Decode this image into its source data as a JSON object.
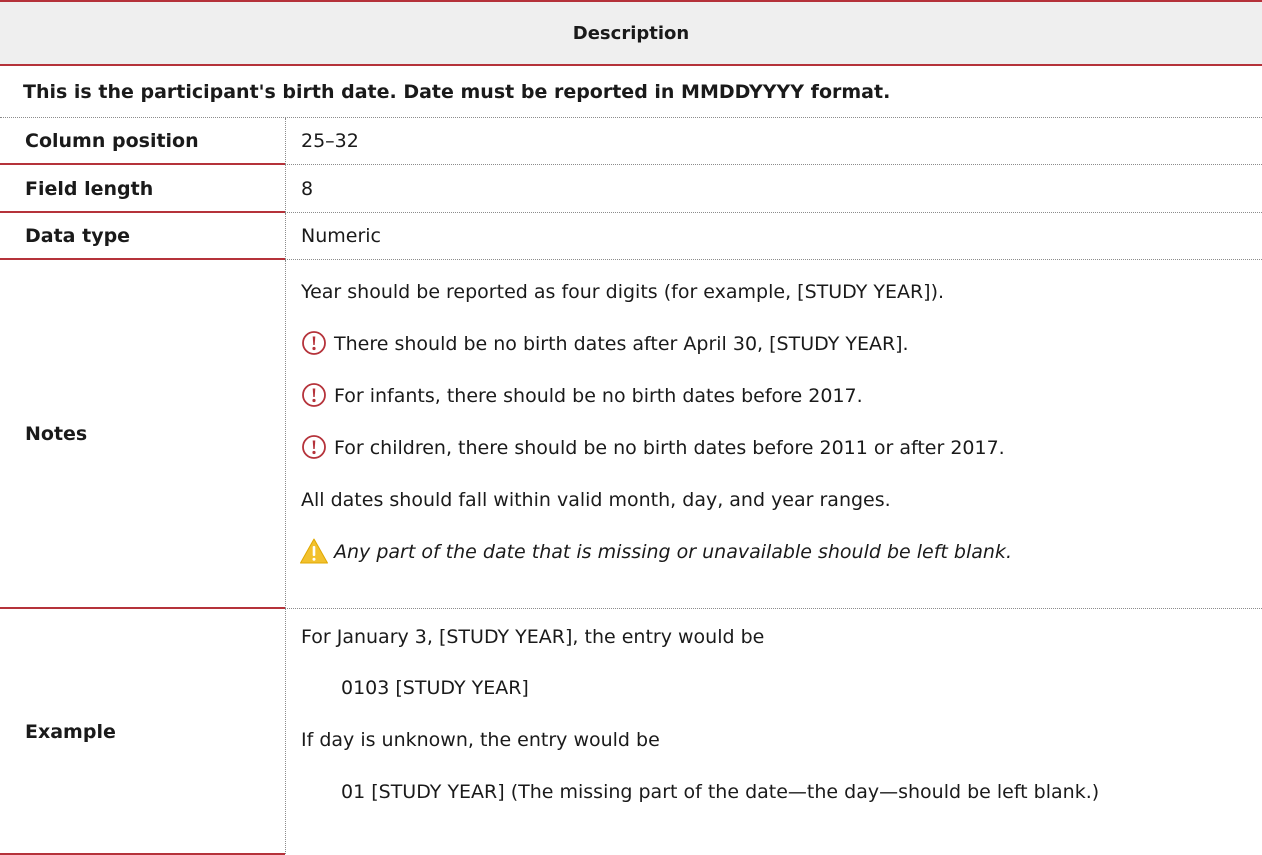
{
  "header": {
    "title": "Description"
  },
  "description": "This is the participant's birth date. Date must be reported in MMDDYYYY format.",
  "rows": {
    "column_position": {
      "label": "Column position",
      "value": "25–32"
    },
    "field_length": {
      "label": "Field length",
      "value": "8"
    },
    "data_type": {
      "label": "Data type",
      "value": "Numeric"
    },
    "notes": {
      "label": "Notes",
      "lines": [
        "Year should be reported as four digits (for example, [STUDY YEAR]).",
        "There should be no birth dates after April 30, [STUDY YEAR].",
        "For infants, there should be no birth dates before 2017.",
        "For children, there should be no birth dates before 2011 or after 2017.",
        "All dates should fall within valid month, day, and year ranges.",
        "Any part of the date that is missing or unavailable should be left blank."
      ]
    },
    "example": {
      "label": "Example",
      "lines": [
        "For January 3, [STUDY YEAR], the entry would be",
        "0103 [STUDY YEAR]",
        "If day is unknown, the entry would be",
        "01 [STUDY YEAR] (The missing part of the date—the day—should be left blank.)"
      ]
    }
  },
  "icons": {
    "alert": "exclamation-circle-icon",
    "warning": "warning-triangle-icon"
  },
  "colors": {
    "accent": "#b5323a",
    "header_bg": "#efefef",
    "warning": "#f2c12e"
  }
}
